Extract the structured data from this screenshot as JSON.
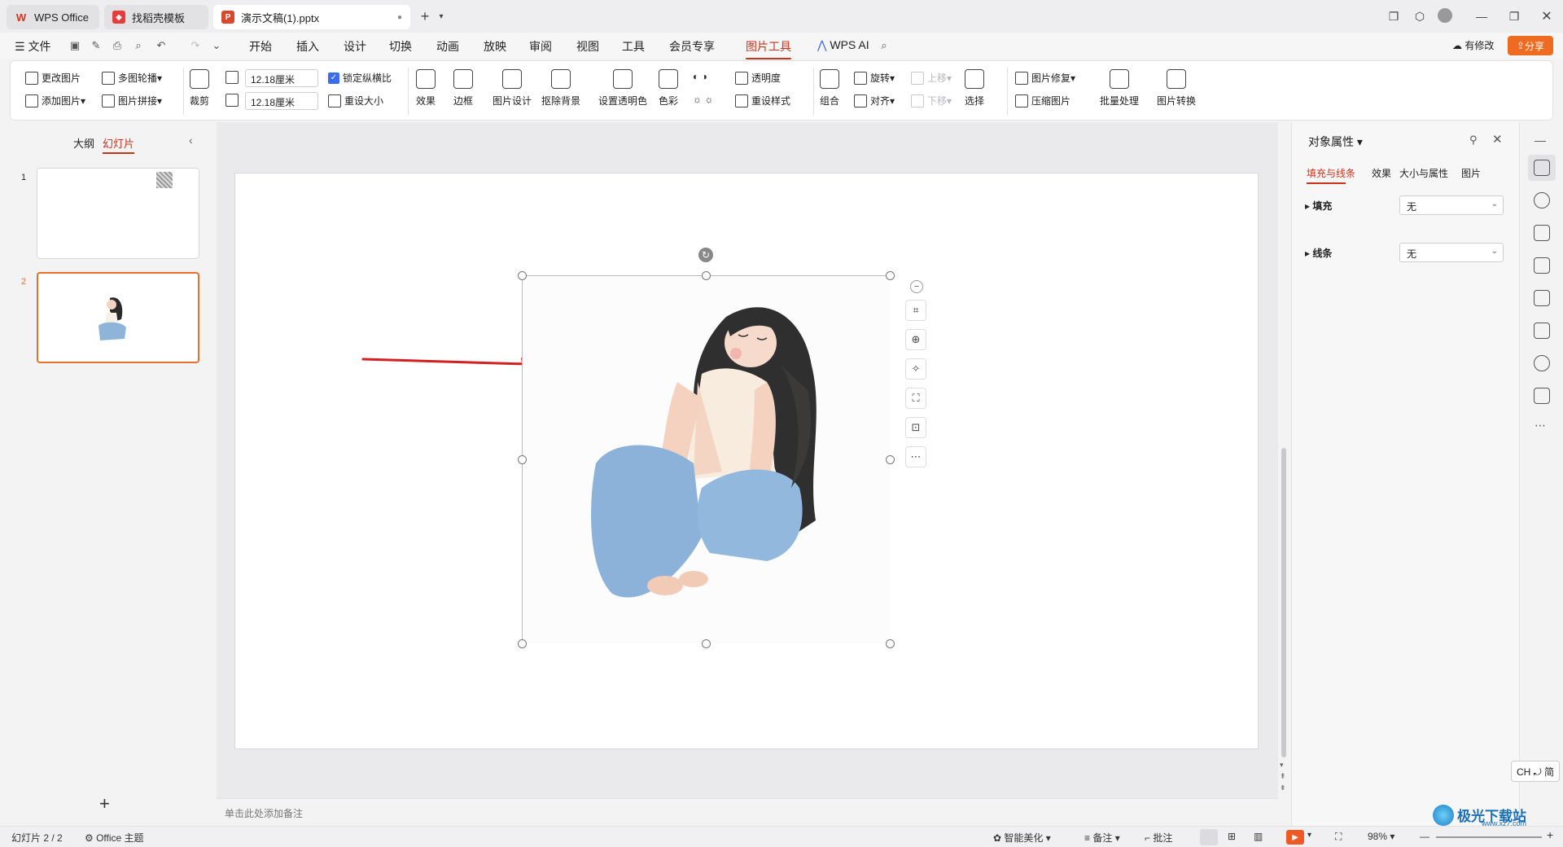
{
  "tabs": [
    {
      "label": "WPS Office",
      "icon": "wps-logo-icon",
      "color": "#d6321f"
    },
    {
      "label": "找稻壳模板",
      "icon": "docer-icon",
      "color": "#e53c3c"
    },
    {
      "label": "演示文稿(1).pptx",
      "icon": "pptx-icon",
      "color": "#d8482a"
    }
  ],
  "menubar": {
    "file": "文件",
    "items": [
      "开始",
      "插入",
      "设计",
      "切换",
      "动画",
      "放映",
      "审阅",
      "视图",
      "工具",
      "会员专享",
      "图片工具"
    ],
    "active": "图片工具",
    "wps_ai": "WPS AI",
    "has_changes": "有修改",
    "share": "分享"
  },
  "ribbon": {
    "change_picture": "更改图片",
    "multi_carousel": "多图轮播",
    "add_picture": "添加图片",
    "picture_collage": "图片拼接",
    "crop": "裁剪",
    "width": "12.18厘米",
    "height": "12.18厘米",
    "lock_ratio": "锁定纵横比",
    "reset_size": "重设大小",
    "effects": "效果",
    "border": "边框",
    "picture_design": "图片设计",
    "remove_bg": "抠除背景",
    "set_transparent": "设置透明色",
    "color": "色彩",
    "transparency": "透明度",
    "reset_style": "重设样式",
    "group": "组合",
    "rotate": "旋转",
    "align": "对齐",
    "bring_forward": "上移",
    "send_backward": "下移",
    "select": "选择",
    "picture_repair": "图片修复",
    "compress": "压缩图片",
    "batch": "批量处理",
    "convert": "图片转换"
  },
  "leftpane": {
    "outline": "大纲",
    "slides": "幻灯片",
    "slide_numbers": [
      "1",
      "2"
    ]
  },
  "notes_placeholder": "单击此处添加备注",
  "rightpane": {
    "title": "对象属性",
    "tabs": [
      "填充与线条",
      "效果",
      "大小与属性",
      "图片"
    ],
    "fill_label": "填充",
    "fill_value": "无",
    "line_label": "线条",
    "line_value": "无"
  },
  "ime": "CH ⤾ 简",
  "status": {
    "slide_info": "幻灯片 2 / 2",
    "theme": "Office 主题",
    "beautify": "智能美化",
    "notes": "备注",
    "comments": "批注",
    "zoom": "98%"
  },
  "watermark": {
    "text": "极光下载站",
    "url": "www.xz7.com"
  },
  "colors": {
    "accent": "#c8331b",
    "selection": "#e8702a",
    "arrow": "#d42020"
  }
}
